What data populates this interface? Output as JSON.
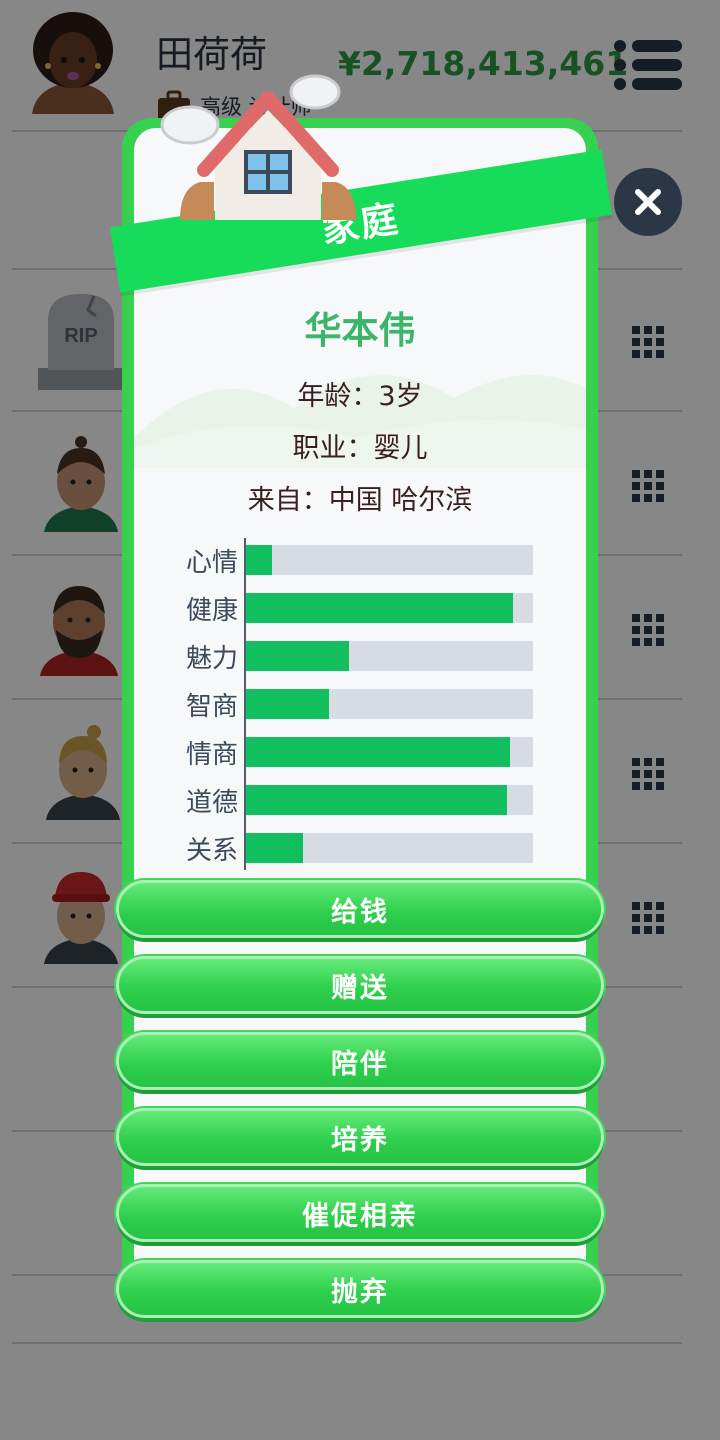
{
  "header": {
    "player_name": "田荷荷",
    "money": "¥2,718,413,461",
    "job_visible": "高级 设计师"
  },
  "background": {
    "rip_text": "RIP"
  },
  "dialog": {
    "title": "家庭",
    "person_name": "华本伟",
    "age_line": "年龄：3岁",
    "job_line": "职业：婴儿",
    "from_line": "来自：中国 哈尔滨",
    "stats": [
      {
        "label": "心情",
        "value": 0.09
      },
      {
        "label": "健康",
        "value": 0.93
      },
      {
        "label": "魅力",
        "value": 0.36
      },
      {
        "label": "智商",
        "value": 0.29
      },
      {
        "label": "情商",
        "value": 0.92
      },
      {
        "label": "道德",
        "value": 0.91
      },
      {
        "label": "关系",
        "value": 0.2
      }
    ],
    "actions": [
      {
        "label": "给钱"
      },
      {
        "label": "赠送"
      },
      {
        "label": "陪伴"
      },
      {
        "label": "培养"
      },
      {
        "label": "催促相亲"
      },
      {
        "label": "抛弃"
      }
    ]
  },
  "colors": {
    "accent_green": "#17dc5a",
    "bar_fill": "#11bf5e",
    "bar_track": "#d7dce2",
    "name_green": "#3cb56a",
    "money_green": "#2f9a45"
  }
}
